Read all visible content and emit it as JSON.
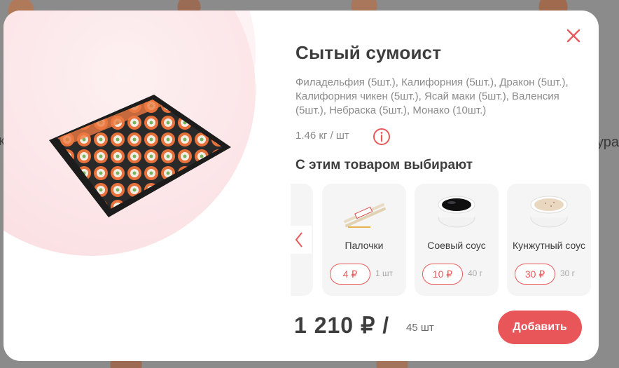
{
  "product": {
    "title": "Сытый сумоист",
    "description": "Филадельфия (5шт.), Калифорния (5шт.), Дракон (5шт.), Калифорния чикен (5шт.), Ясай маки (5шт.), Валенсия (5шт.), Небраска (5шт.), Монако (10шт.)",
    "weight": "1.46 кг / шт",
    "price": "1 210 ₽ /",
    "quantity": "45 шт",
    "add_button": "Добавить"
  },
  "recommendations": {
    "title": "С этим товаром выбирают",
    "items": [
      {
        "name": "Палочки",
        "price": "4 ₽",
        "qty": "1 шт",
        "icon": "chopsticks-icon"
      },
      {
        "name": "Соевый соус",
        "price": "10 ₽",
        "qty": "40 г",
        "icon": "soy-sauce-icon"
      },
      {
        "name": "Кунжутный соус",
        "price": "30 ₽",
        "qty": "30 г",
        "icon": "sesame-sauce-icon"
      }
    ]
  },
  "background": {
    "left_fragment": "к",
    "right_fragment": "ура"
  },
  "colors": {
    "accent": "#e9565a",
    "title": "#3d3d3d",
    "muted": "#8a8a8a",
    "card_bg": "#f5f5f5"
  }
}
